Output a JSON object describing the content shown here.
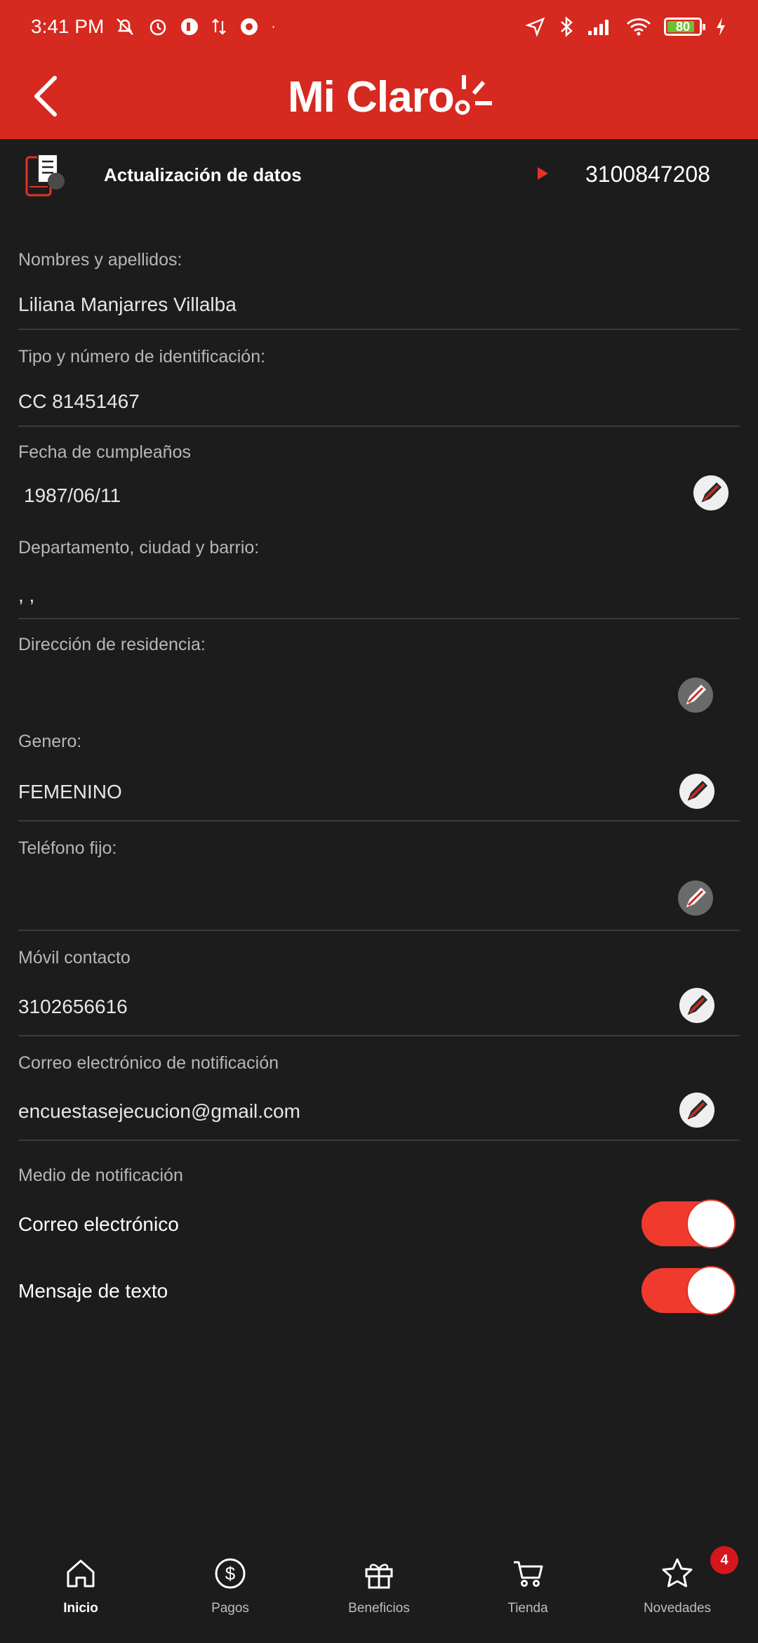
{
  "status_bar": {
    "time": "3:41 PM",
    "battery": "80"
  },
  "app_bar": {
    "logo": "Mi Claro"
  },
  "header": {
    "title": "Actualización de datos",
    "number": "3100847208"
  },
  "fields": {
    "nombres": {
      "label": "Nombres y apellidos:",
      "value": "Liliana Manjarres Villalba"
    },
    "identificacion": {
      "label": "Tipo y número de identificación:",
      "value": "CC 81451467"
    },
    "cumpleanos": {
      "label": "Fecha de cumpleaños",
      "value": "1987/06/11"
    },
    "departamento": {
      "label": "Departamento, ciudad y barrio:",
      "value": ", ,"
    },
    "direccion": {
      "label": "Dirección de residencia:",
      "value": ""
    },
    "genero": {
      "label": "Genero:",
      "value": "FEMENINO"
    },
    "telefono_fijo": {
      "label": "Teléfono fijo:",
      "value": ""
    },
    "movil": {
      "label": "Móvil contacto",
      "value": "3102656616"
    },
    "correo": {
      "label": "Correo electrónico de notificación",
      "value": "encuestasejecucion@gmail.com"
    }
  },
  "notificacion": {
    "title": "Medio de notificación",
    "options": [
      {
        "label": "Correo electrónico",
        "enabled": true
      },
      {
        "label": "Mensaje de texto",
        "enabled": true
      }
    ]
  },
  "bottom_nav": {
    "items": [
      {
        "label": "Inicio",
        "icon": "home-icon",
        "active": true
      },
      {
        "label": "Pagos",
        "icon": "dollar-icon",
        "active": false
      },
      {
        "label": "Beneficios",
        "icon": "gift-icon",
        "active": false
      },
      {
        "label": "Tienda",
        "icon": "cart-icon",
        "active": false
      },
      {
        "label": "Novedades",
        "icon": "star-icon",
        "active": false
      }
    ],
    "badge": "4"
  },
  "colors": {
    "brand_red": "#d6291f",
    "background": "#1c1c1c",
    "toggle_on": "#f03a2e"
  }
}
